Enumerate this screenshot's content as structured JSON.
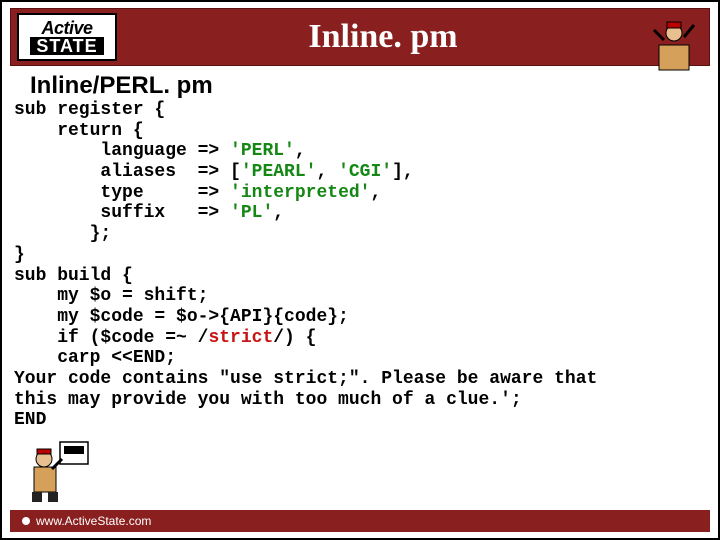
{
  "logo": {
    "top": "Active",
    "bottom": "STATE"
  },
  "title": "Inline. pm",
  "subtitle": "Inline/PERL. pm",
  "code": {
    "l1": "sub register {",
    "l2": "    return {",
    "l3a": "        language => ",
    "l3b": "'PERL'",
    "l3c": ",",
    "l4a": "        aliases  => [",
    "l4b": "'PEARL'",
    "l4c": ", ",
    "l4d": "'CGI'",
    "l4e": "],",
    "l5a": "        type     => ",
    "l5b": "'interpreted'",
    "l5c": ",",
    "l6a": "        suffix   => ",
    "l6b": "'PL'",
    "l6c": ",",
    "l7": "       };",
    "l8": "}",
    "l9": "sub build {",
    "l10": "    my $o = shift;",
    "l11": "    my $code = $o->{API}{code};",
    "l12a": "    if ($code =~ /",
    "l12b": "strict",
    "l12c": "/) {",
    "l13": "    carp <<END;",
    "l14": "Your code contains \"use strict;\". Please be aware that",
    "l15": "this may provide you with too much of a clue.';",
    "l16": "END"
  },
  "footer": "www.ActiveState.com"
}
